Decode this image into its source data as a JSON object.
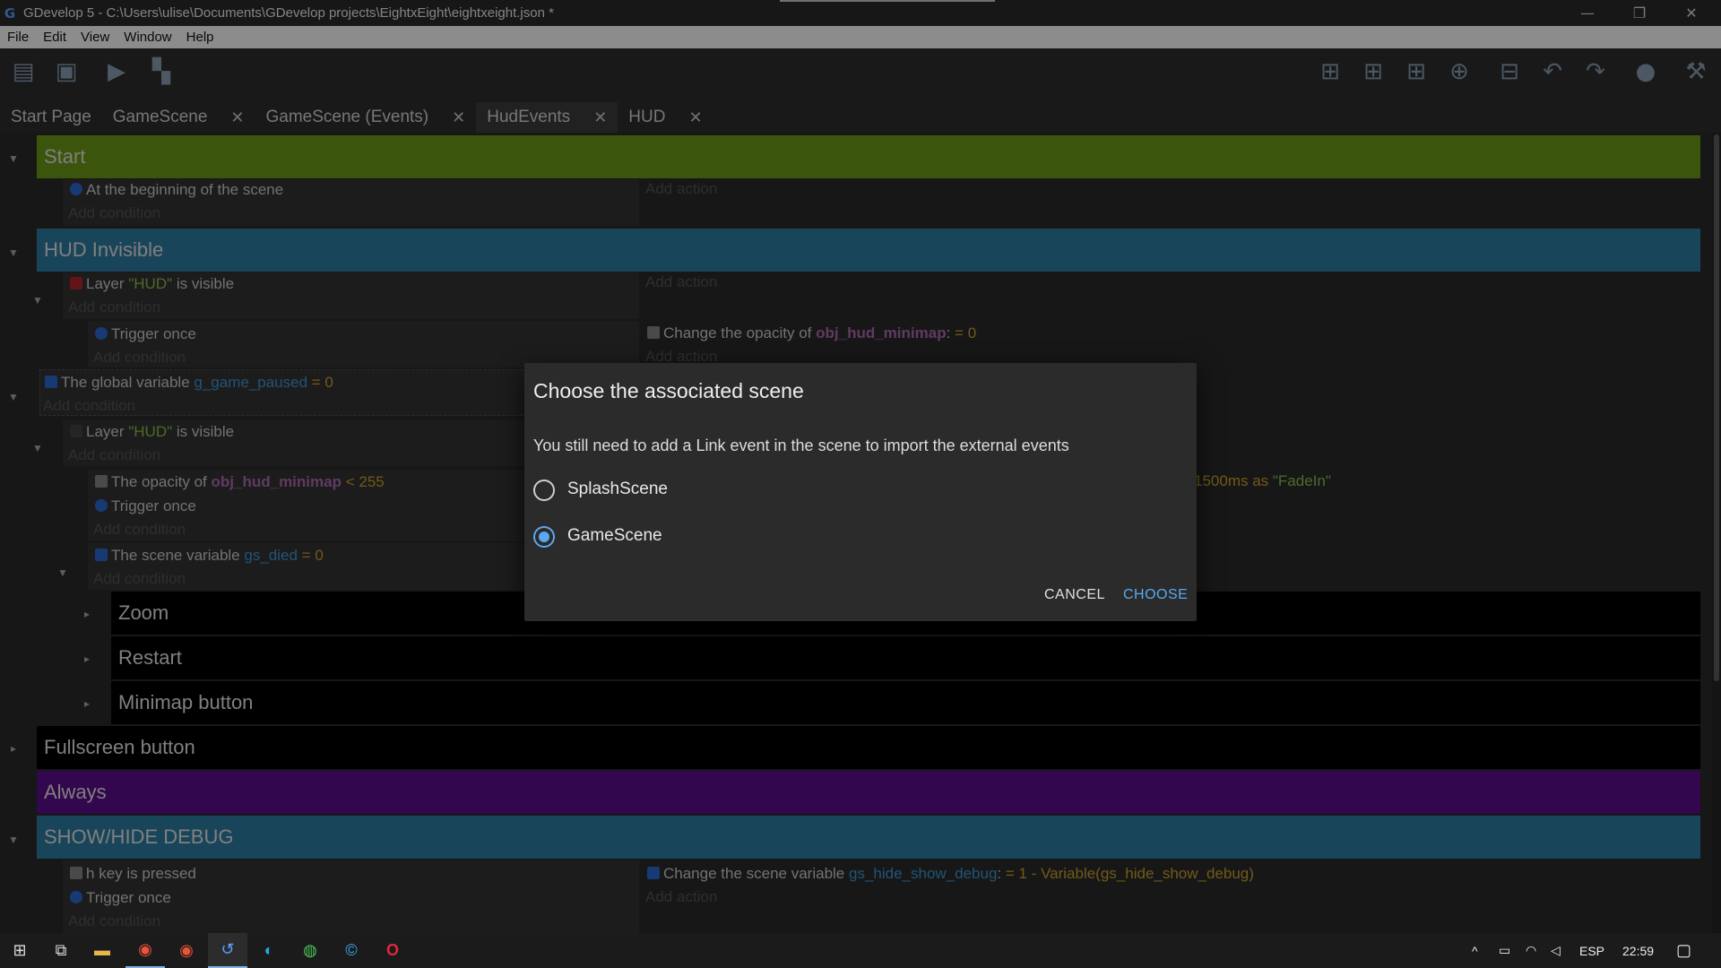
{
  "window": {
    "title": "GDevelop 5 - C:\\Users\\ulise\\Documents\\GDevelop projects\\EightxEight\\eightxeight.json *",
    "minimize": "—",
    "restore": "❐",
    "close": "✕"
  },
  "menu": {
    "file": "File",
    "edit": "Edit",
    "view": "View",
    "window": "Window",
    "help": "Help"
  },
  "toolbar_icons": {
    "project_manager": "▤",
    "scene_editor": "▣",
    "preview": "▶",
    "debug": "▚",
    "add_event": "⊞",
    "add_subevent": "⊞",
    "add_comment": "⊞",
    "add_other": "⊕",
    "delete": "⊟",
    "undo": "↶",
    "redo": "↷",
    "search": "●",
    "settings": "⚒"
  },
  "tabs": [
    {
      "label": "Start Page"
    },
    {
      "label": "GameScene",
      "close": "✕"
    },
    {
      "label": "GameScene (Events)",
      "close": "✕"
    },
    {
      "label": "HudEvents",
      "close": "✕"
    },
    {
      "label": "HUD",
      "close": "✕"
    }
  ],
  "events": {
    "add_condition": "Add condition",
    "add_action": "Add action",
    "start": {
      "title": "Start",
      "cond": "At the beginning of the scene"
    },
    "hud_invisible": {
      "title": "HUD Invisible",
      "cond1_a": "Layer ",
      "cond1_str": "\"HUD\"",
      "cond1_b": " is visible",
      "trigger_once": "Trigger once",
      "action_a": "Change the opacity of ",
      "action_obj": "obj_hud_minimap",
      "action_b": ": ",
      "action_val": "= 0"
    },
    "global_var": {
      "a": "The global variable ",
      "var": "g_game_paused",
      "val": "= 0"
    },
    "layer_visible": {
      "a": "Layer ",
      "str": "\"HUD\"",
      "b": " is visible"
    },
    "opacity": {
      "a": "The opacity of ",
      "obj": "obj_hud_minimap",
      "val": "< 255"
    },
    "fade_action": {
      "a": "1500ms as ",
      "str": "\"FadeIn\""
    },
    "scene_var": {
      "a": "The scene variable ",
      "var": "gs_died",
      "val": "= 0"
    },
    "groups": {
      "zoom": "Zoom",
      "restart": "Restart",
      "minimap": "Minimap button",
      "fullscreen": "Fullscreen button",
      "always": "Always",
      "debug": "SHOW/HIDE DEBUG"
    },
    "debug_events": {
      "key_a": "h",
      "key_b": " key is pressed",
      "action_a": "Change the scene variable ",
      "action_var": "gs_hide_show_debug",
      "action_b": ": ",
      "action_val": "= 1 - Variable(gs_hide_show_debug)"
    }
  },
  "dialog": {
    "title": "Choose the associated scene",
    "message": "You still need to add a Link event in the scene to import the external events",
    "options": [
      {
        "label": "SplashScene",
        "checked": false
      },
      {
        "label": "GameScene",
        "checked": true
      }
    ],
    "cancel": "CANCEL",
    "choose": "CHOOSE"
  },
  "taskbar": {
    "start_icon": "⊞",
    "taskview_icon": "⧉",
    "explorer_icon": "▬",
    "chrome_icon": "◉",
    "chrome2_icon": "◉",
    "gdevelop_icon": "↺",
    "edge_icon": "◐",
    "spotify_icon": "◍",
    "cortana_icon": "©",
    "opera_icon": "O",
    "tray_chevron": "^",
    "tray_battery": "▭",
    "tray_wifi": "◠",
    "tray_volume": "◁",
    "language": "ESP",
    "clock": "22:59",
    "notifications_icon": "▢"
  }
}
